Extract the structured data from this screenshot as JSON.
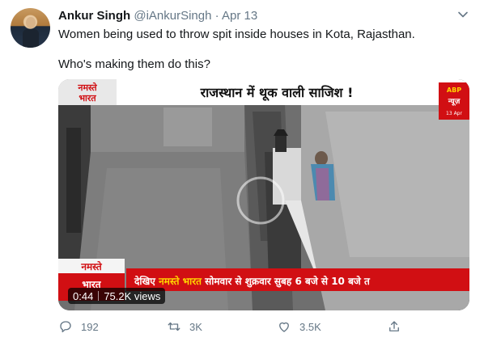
{
  "tweet": {
    "author_name": "Ankur Singh",
    "author_handle": "@iAnkurSingh",
    "separator": "·",
    "date": "Apr 13",
    "line1": "Women being used to throw spit inside houses in Kota, Rajasthan.",
    "line2": "Who's making them do this?"
  },
  "video": {
    "headline": "राजस्थान में थूक वाली साजिश !",
    "channel_logo_top": "नमस्ते",
    "channel_logo_bottom": "भारत",
    "abp_line1": "ABP",
    "abp_line2": "न्यूज़",
    "abp_date": "13 Apr",
    "ticker_prefix": "देखिए",
    "ticker_highlight": "नमस्ते भारत",
    "ticker_suffix": "सोमवार से शुक्रवार सुबह 6 बजे से 10 बजे त",
    "duration": "0:44",
    "views": "75.2K views"
  },
  "actions": {
    "replies": "192",
    "retweets": "3K",
    "likes": "3.5K"
  },
  "colors": {
    "ticker_red": "#d10f13",
    "ticker_yellow": "#ffd400",
    "secondary_text": "#657786"
  }
}
